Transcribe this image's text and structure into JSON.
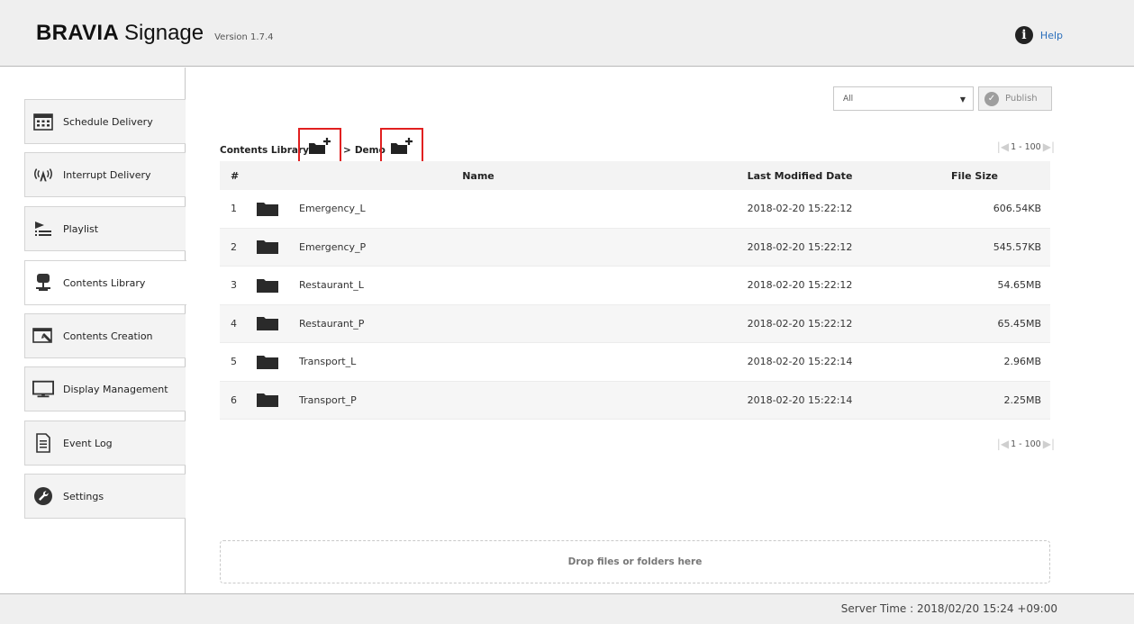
{
  "header": {
    "brand_bold": "BRAVIA",
    "brand_light": "Signage",
    "version": "Version 1.7.4",
    "help_label": "Help",
    "help_icon": "info-icon"
  },
  "sidebar": {
    "items": [
      {
        "label": "Schedule Delivery",
        "icon": "calendar-icon",
        "active": false
      },
      {
        "label": "Interrupt Delivery",
        "icon": "broadcast-icon",
        "active": false
      },
      {
        "label": "Playlist",
        "icon": "playlist-icon",
        "active": false
      },
      {
        "label": "Contents Library",
        "icon": "database-icon",
        "active": true
      },
      {
        "label": "Contents Creation",
        "icon": "edit-window-icon",
        "active": false
      },
      {
        "label": "Display Management",
        "icon": "monitor-icon",
        "active": false
      },
      {
        "label": "Event Log",
        "icon": "document-icon",
        "active": false
      },
      {
        "label": "Settings",
        "icon": "wrench-icon",
        "active": false
      }
    ]
  },
  "toolbar": {
    "filter_value": "All",
    "publish_label": "Publish"
  },
  "breadcrumb": {
    "root": "Contents Library",
    "separator": ">",
    "current": "Demo"
  },
  "pager": {
    "range": "1 - 100"
  },
  "table": {
    "headers": {
      "num": "#",
      "name": "Name",
      "date": "Last Modified Date",
      "size": "File Size"
    },
    "rows": [
      {
        "num": "1",
        "name": "Emergency_L",
        "date": "2018-02-20 15:22:12",
        "size": "606.54KB"
      },
      {
        "num": "2",
        "name": "Emergency_P",
        "date": "2018-02-20 15:22:12",
        "size": "545.57KB"
      },
      {
        "num": "3",
        "name": "Restaurant_L",
        "date": "2018-02-20 15:22:12",
        "size": "54.65MB"
      },
      {
        "num": "4",
        "name": "Restaurant_P",
        "date": "2018-02-20 15:22:12",
        "size": "65.45MB"
      },
      {
        "num": "5",
        "name": "Transport_L",
        "date": "2018-02-20 15:22:14",
        "size": "2.96MB"
      },
      {
        "num": "6",
        "name": "Transport_P",
        "date": "2018-02-20 15:22:14",
        "size": "2.25MB"
      }
    ]
  },
  "dropzone": {
    "label": "Drop files or folders here"
  },
  "footer": {
    "server_time": "Server Time : 2018/02/20 15:24 +09:00"
  },
  "colors": {
    "accent_link": "#2a6ebb",
    "highlight_box": "#e12020",
    "header_bg": "#efefef"
  }
}
